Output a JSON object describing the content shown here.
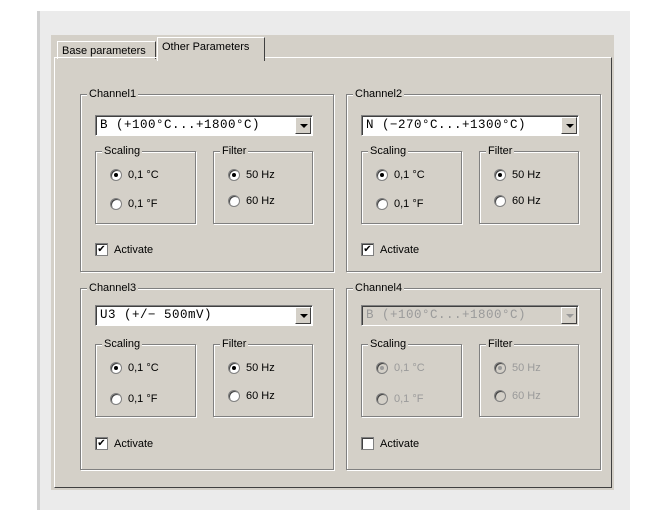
{
  "tabs": [
    {
      "label": "Base parameters",
      "active": false
    },
    {
      "label": "Other Parameters",
      "active": true
    }
  ],
  "channels": [
    {
      "name": "Channel1",
      "sensor": "B  (+100°C...+1800°C)",
      "enabled": true,
      "scaling": {
        "title": "Scaling",
        "options": [
          "0,1 °C",
          "0,1 °F"
        ],
        "selected": 0
      },
      "filter": {
        "title": "Filter",
        "options": [
          "50 Hz",
          "60 Hz"
        ],
        "selected": 0
      },
      "activate": {
        "label": "Activate",
        "checked": true
      }
    },
    {
      "name": "Channel2",
      "sensor": "N  (−270°C...+1300°C)",
      "enabled": true,
      "scaling": {
        "title": "Scaling",
        "options": [
          "0,1 °C",
          "0,1 °F"
        ],
        "selected": 0
      },
      "filter": {
        "title": "Filter",
        "options": [
          "50 Hz",
          "60 Hz"
        ],
        "selected": 0
      },
      "activate": {
        "label": "Activate",
        "checked": true
      }
    },
    {
      "name": "Channel3",
      "sensor": "U3 (+/− 500mV)",
      "enabled": true,
      "scaling": {
        "title": "Scaling",
        "options": [
          "0,1 °C",
          "0,1 °F"
        ],
        "selected": 0
      },
      "filter": {
        "title": "Filter",
        "options": [
          "50 Hz",
          "60 Hz"
        ],
        "selected": 0
      },
      "activate": {
        "label": "Activate",
        "checked": true
      }
    },
    {
      "name": "Channel4",
      "sensor": "B  (+100°C...+1800°C)",
      "enabled": false,
      "scaling": {
        "title": "Scaling",
        "options": [
          "0,1 °C",
          "0,1 °F"
        ],
        "selected": 0
      },
      "filter": {
        "title": "Filter",
        "options": [
          "50 Hz",
          "60 Hz"
        ],
        "selected": 0
      },
      "activate": {
        "label": "Activate",
        "checked": false
      }
    }
  ]
}
